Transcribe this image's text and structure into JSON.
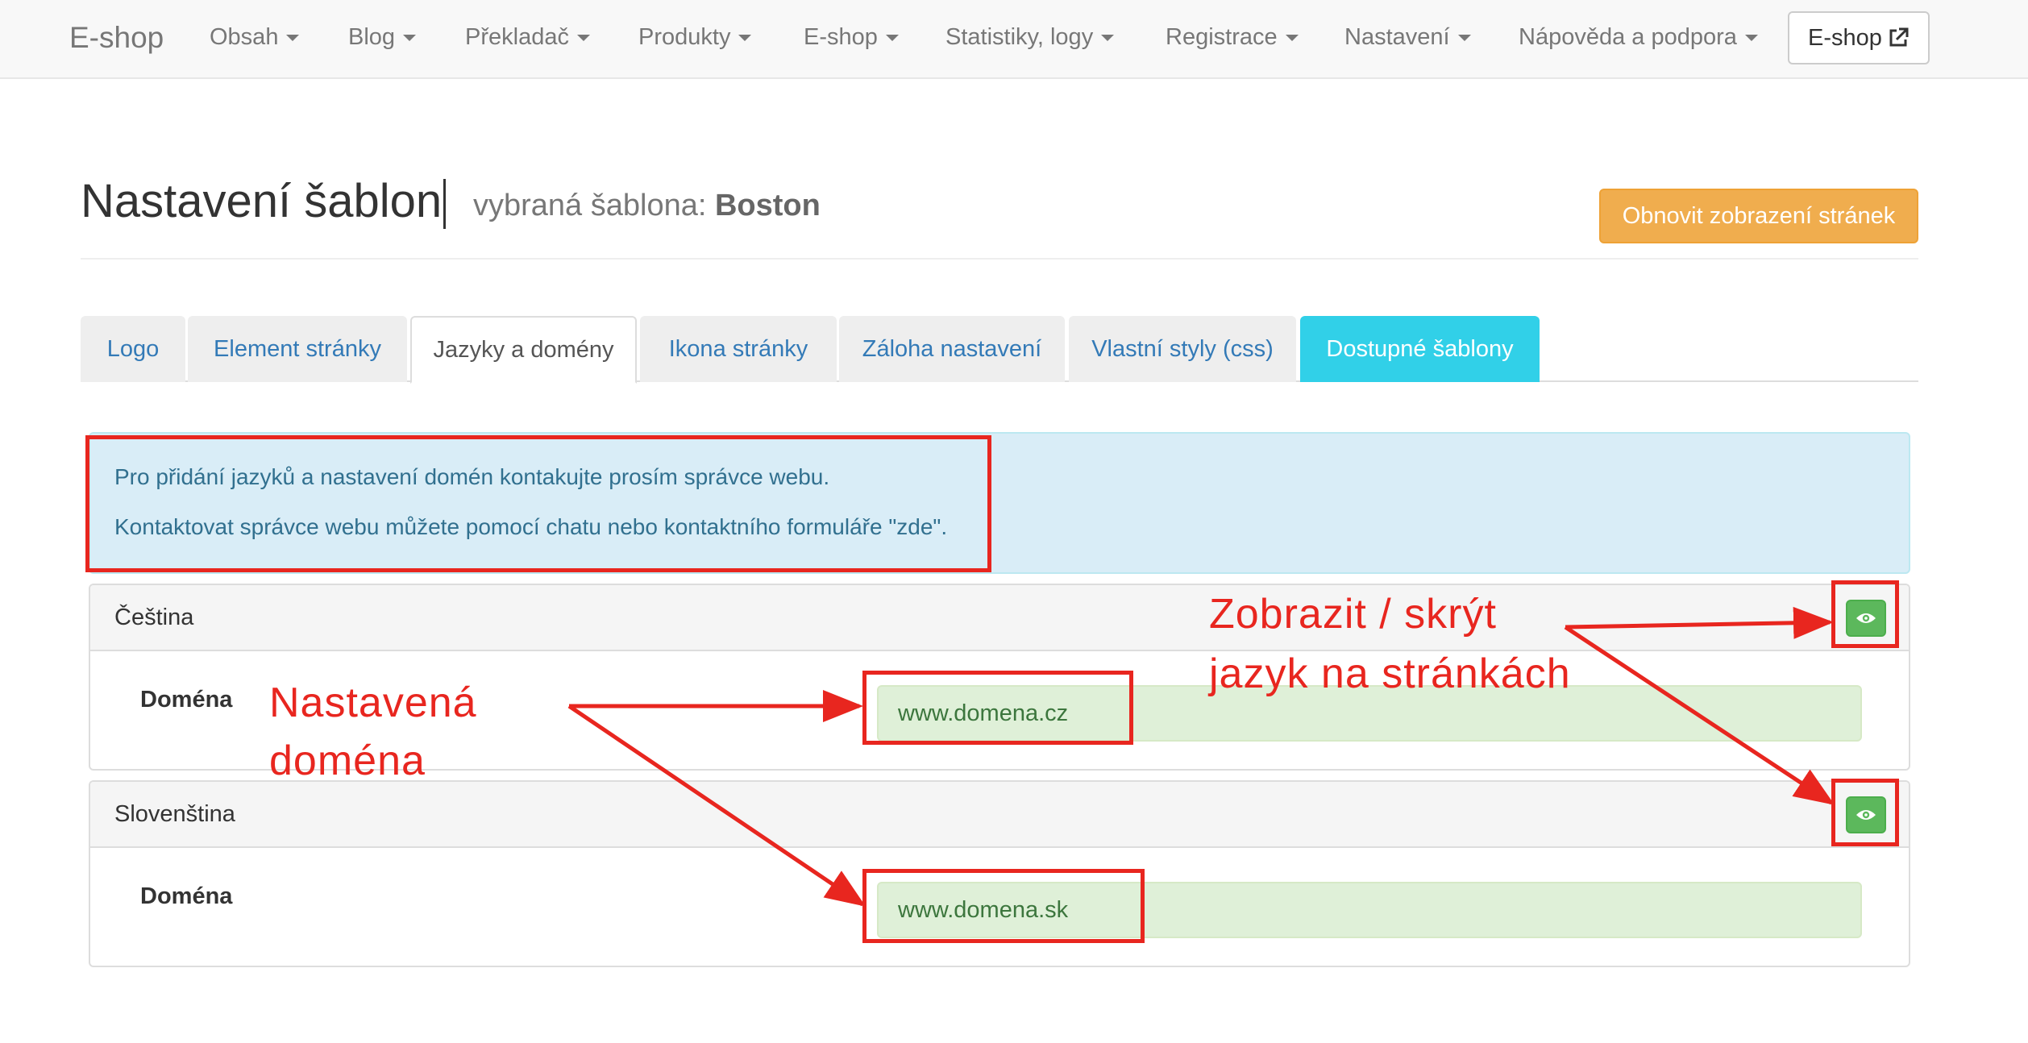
{
  "navbar": {
    "brand": "E-shop",
    "items": [
      {
        "label": "Obsah"
      },
      {
        "label": "Blog"
      },
      {
        "label": "Překladač"
      },
      {
        "label": "Produkty"
      },
      {
        "label": "E-shop"
      },
      {
        "label": "Statistiky, logy"
      },
      {
        "label": "Registrace"
      },
      {
        "label": "Nastavení"
      },
      {
        "label": "Nápověda a podpora"
      }
    ],
    "eshop_button": "E-shop"
  },
  "header": {
    "title": "Nastavení šablon",
    "subtitle_prefix": "vybraná šablona:",
    "template_name": "Boston",
    "refresh_button": "Obnovit zobrazení stránek"
  },
  "tabs": [
    {
      "label": "Logo"
    },
    {
      "label": "Element stránky"
    },
    {
      "label": "Jazyky a domény",
      "active": true
    },
    {
      "label": "Ikona stránky"
    },
    {
      "label": "Záloha nastavení"
    },
    {
      "label": "Vlastní styly (css)"
    },
    {
      "label": "Dostupné šablony"
    }
  ],
  "alert": {
    "line1": "Pro přidání jazyků a nastavení domén kontakujte prosím správce webu.",
    "line2": "Kontaktovat správce webu můžete pomocí chatu nebo kontaktního formuláře \"zde\"."
  },
  "languages": [
    {
      "name": "Čeština",
      "domain_label": "Doména",
      "domain_value": "www.domena.cz"
    },
    {
      "name": "Slovenština",
      "domain_label": "Doména",
      "domain_value": "www.domena.sk"
    }
  ],
  "annotations": {
    "domain_line1": "Nastavená",
    "domain_line2": "doména",
    "toggle_line1": "Zobrazit / skrýt",
    "toggle_line2": "jazyk na stránkách"
  },
  "colors": {
    "annotation": "#e8261f",
    "refresh_button": "#f0ad4e",
    "info_tab": "#31d0e8",
    "alert_bg": "#d9edf7",
    "toggle_button": "#5cb85c",
    "input_bg": "#dff0d8"
  },
  "icons": {
    "nav_external": "external-link-icon",
    "toggle": "eye-icon",
    "dropdown": "caret-down-icon"
  }
}
